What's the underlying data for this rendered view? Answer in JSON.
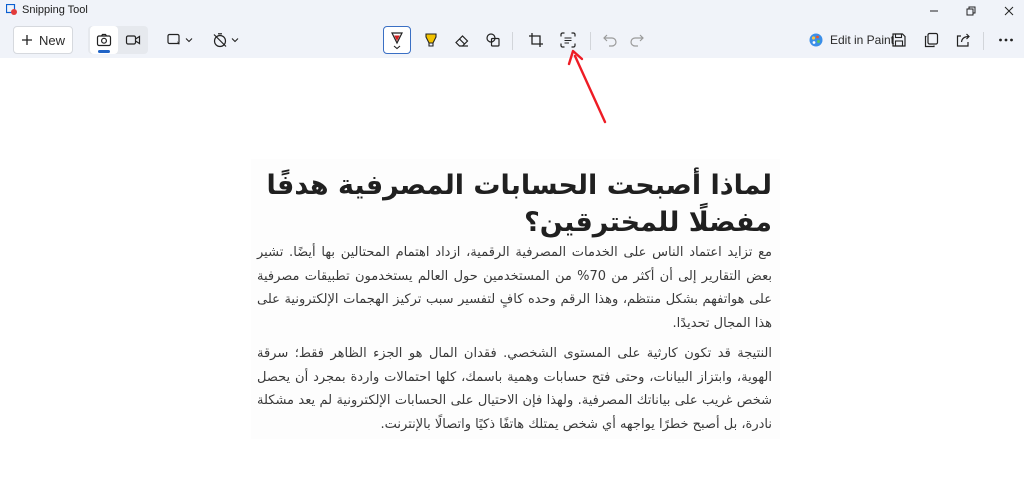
{
  "window": {
    "title": "Snipping Tool"
  },
  "toolbar": {
    "new_label": "New",
    "edit_in_paint_label": "Edit in Paint"
  },
  "icons": {
    "app": "snipping-tool-icon",
    "new": "plus-icon",
    "screenshot_mode": "camera-icon",
    "video_mode": "video-camera-icon",
    "snip_shape": "rectangle-snip-icon",
    "delay": "timer-off-icon",
    "pen": "ballpoint-pen-icon",
    "highlighter": "highlighter-icon",
    "eraser": "eraser-icon",
    "shapes": "shapes-icon",
    "crop": "crop-icon",
    "text_actions": "text-actions-icon",
    "undo": "undo-icon",
    "redo": "redo-icon",
    "paint": "paint-icon",
    "save": "save-icon",
    "copy": "copy-icon",
    "share": "share-icon",
    "more": "more-icon"
  },
  "colors": {
    "pen_active": "#d32020",
    "highlighter": "#f2c200",
    "annotation_arrow": "#ee1c25",
    "selected_border": "#3a6fc4"
  },
  "document": {
    "title": "لماذا أصبحت الحسابات المصرفية هدفًا مفضلًا للمخترقين؟",
    "paragraph1": "مع تزايد اعتماد الناس على الخدمات المصرفية الرقمية، ازداد اهتمام المحتالين بها أيضًا. تشير بعض التقارير إلى أن أكثر من 70% من المستخدمين حول العالم يستخدمون تطبيقات مصرفية على هواتفهم بشكل منتظم، وهذا الرقم وحده كافٍ لتفسير سبب تركيز الهجمات الإلكترونية على هذا المجال تحديدًا.",
    "paragraph2": "النتيجة قد تكون كارثية على المستوى الشخصي. فقدان المال هو الجزء الظاهر فقط؛ سرقة الهوية، وابتزاز البيانات، وحتى فتح حسابات وهمية باسمك، كلها احتمالات واردة بمجرد أن يحصل شخص غريب على بياناتك المصرفية. ولهذا فإن الاحتيال على الحسابات الإلكترونية لم يعد مشكلة نادرة، بل أصبح خطرًا يواجهه أي شخص يمتلك هاتفًا ذكيًا واتصالًا بالإنترنت."
  }
}
